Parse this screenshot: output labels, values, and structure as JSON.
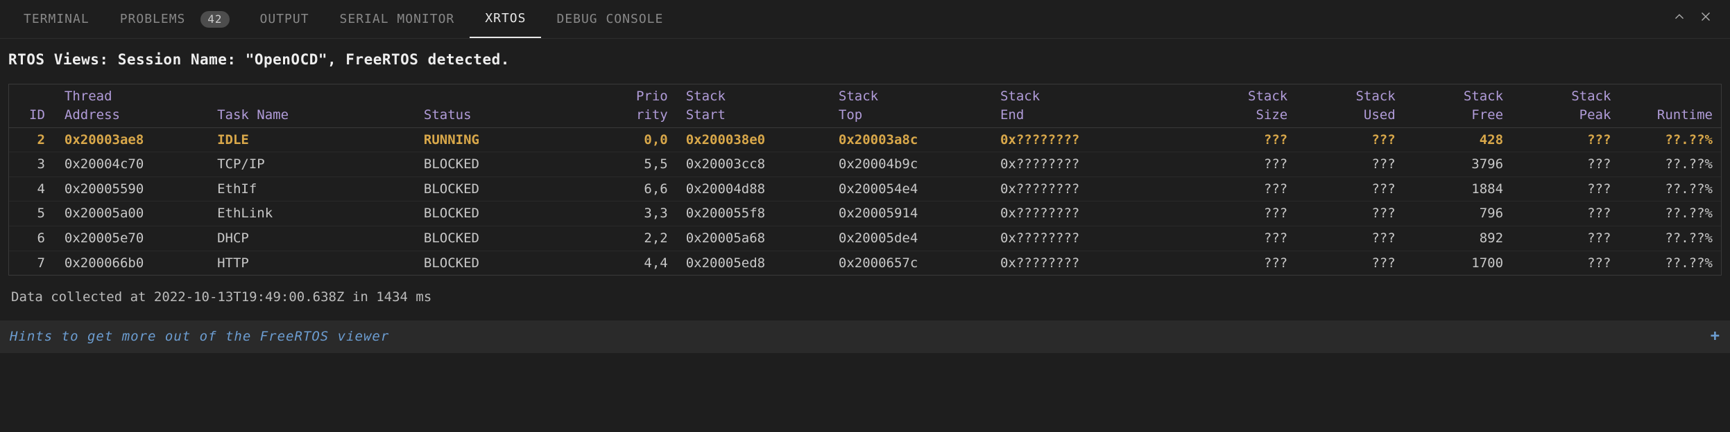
{
  "tabs": {
    "terminal": "TERMINAL",
    "problems": "PROBLEMS",
    "problems_badge": "42",
    "output": "OUTPUT",
    "serial_monitor": "SERIAL MONITOR",
    "xrtos": "XRTOS",
    "debug_console": "DEBUG CONSOLE"
  },
  "heading": "RTOS Views: Session Name: \"OpenOCD\", FreeRTOS detected.",
  "headers": {
    "row1": {
      "thread": "Thread",
      "prio": "Prio",
      "stack": "Stack",
      "stack2": "Stack",
      "stack3": "Stack",
      "stack4": "Stack",
      "stack5": "Stack",
      "stack6": "Stack",
      "stack7": "Stack"
    },
    "row2": {
      "id": "ID",
      "address": "Address",
      "task_name": "Task Name",
      "status": "Status",
      "rity": "rity",
      "start": "Start",
      "top": "Top",
      "end": "End",
      "size": "Size",
      "used": "Used",
      "free": "Free",
      "peak": "Peak",
      "runtime": "Runtime"
    }
  },
  "rows": [
    {
      "id": "2",
      "addr": "0x20003ae8",
      "task": "IDLE",
      "status": "RUNNING",
      "prio": "0,0",
      "start": "0x200038e0",
      "top": "0x20003a8c",
      "end": "0x????????",
      "size": "???",
      "used": "???",
      "free": "428",
      "peak": "???",
      "runtime": "??.??%",
      "highlight": true
    },
    {
      "id": "3",
      "addr": "0x20004c70",
      "task": "TCP/IP",
      "status": "BLOCKED",
      "prio": "5,5",
      "start": "0x20003cc8",
      "top": "0x20004b9c",
      "end": "0x????????",
      "size": "???",
      "used": "???",
      "free": "3796",
      "peak": "???",
      "runtime": "??.??%"
    },
    {
      "id": "4",
      "addr": "0x20005590",
      "task": "EthIf",
      "status": "BLOCKED",
      "prio": "6,6",
      "start": "0x20004d88",
      "top": "0x200054e4",
      "end": "0x????????",
      "size": "???",
      "used": "???",
      "free": "1884",
      "peak": "???",
      "runtime": "??.??%"
    },
    {
      "id": "5",
      "addr": "0x20005a00",
      "task": "EthLink",
      "status": "BLOCKED",
      "prio": "3,3",
      "start": "0x200055f8",
      "top": "0x20005914",
      "end": "0x????????",
      "size": "???",
      "used": "???",
      "free": "796",
      "peak": "???",
      "runtime": "??.??%"
    },
    {
      "id": "6",
      "addr": "0x20005e70",
      "task": "DHCP",
      "status": "BLOCKED",
      "prio": "2,2",
      "start": "0x20005a68",
      "top": "0x20005de4",
      "end": "0x????????",
      "size": "???",
      "used": "???",
      "free": "892",
      "peak": "???",
      "runtime": "??.??%"
    },
    {
      "id": "7",
      "addr": "0x200066b0",
      "task": "HTTP",
      "status": "BLOCKED",
      "prio": "4,4",
      "start": "0x20005ed8",
      "top": "0x2000657c",
      "end": "0x????????",
      "size": "???",
      "used": "???",
      "free": "1700",
      "peak": "???",
      "runtime": "??.??%"
    }
  ],
  "footer": "Data collected at 2022-10-13T19:49:00.638Z in 1434 ms",
  "hints": "Hints to get more out of the FreeRTOS viewer",
  "hints_plus": "+"
}
